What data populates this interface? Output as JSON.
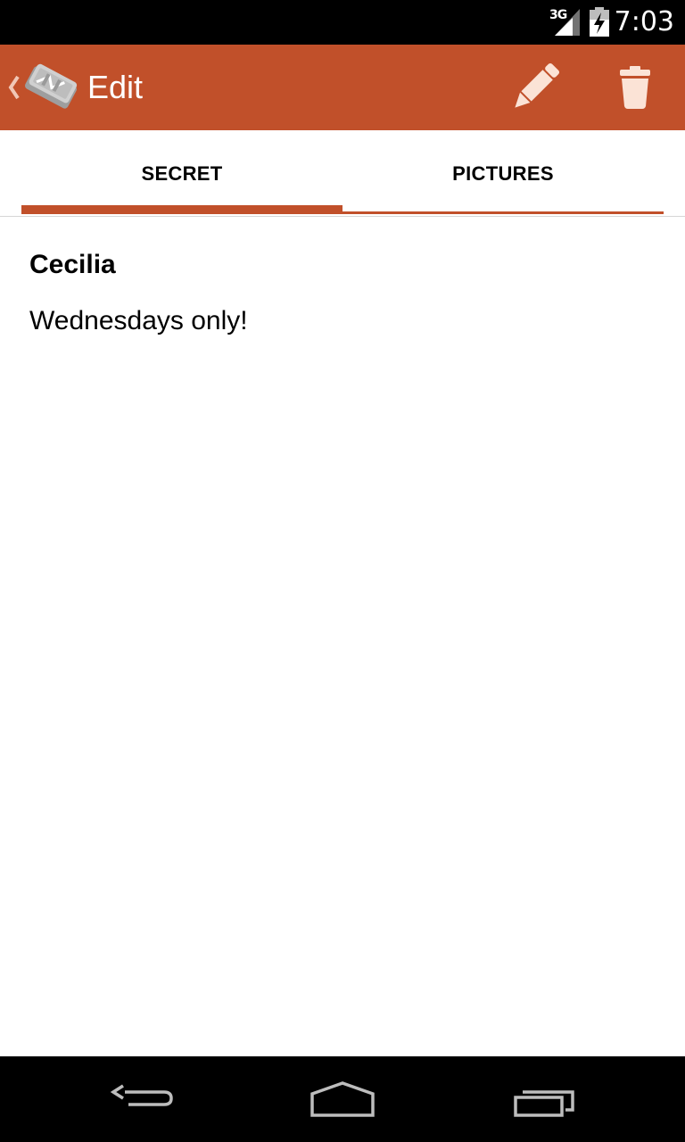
{
  "status_bar": {
    "network": "3G",
    "time": "7:03"
  },
  "action_bar": {
    "title": "Edit",
    "icons": [
      "up-chevron-icon",
      "app-logo-icon",
      "pencil-icon",
      "trash-icon"
    ],
    "background_color": "#c1502a"
  },
  "tabs": [
    {
      "label": "SECRET",
      "selected": true
    },
    {
      "label": "PICTURES",
      "selected": false
    }
  ],
  "content": {
    "name": "Cecilia",
    "body": "Wednesdays only!"
  },
  "nav_bar": {
    "icons": [
      "back-icon",
      "home-icon",
      "recents-icon"
    ]
  }
}
